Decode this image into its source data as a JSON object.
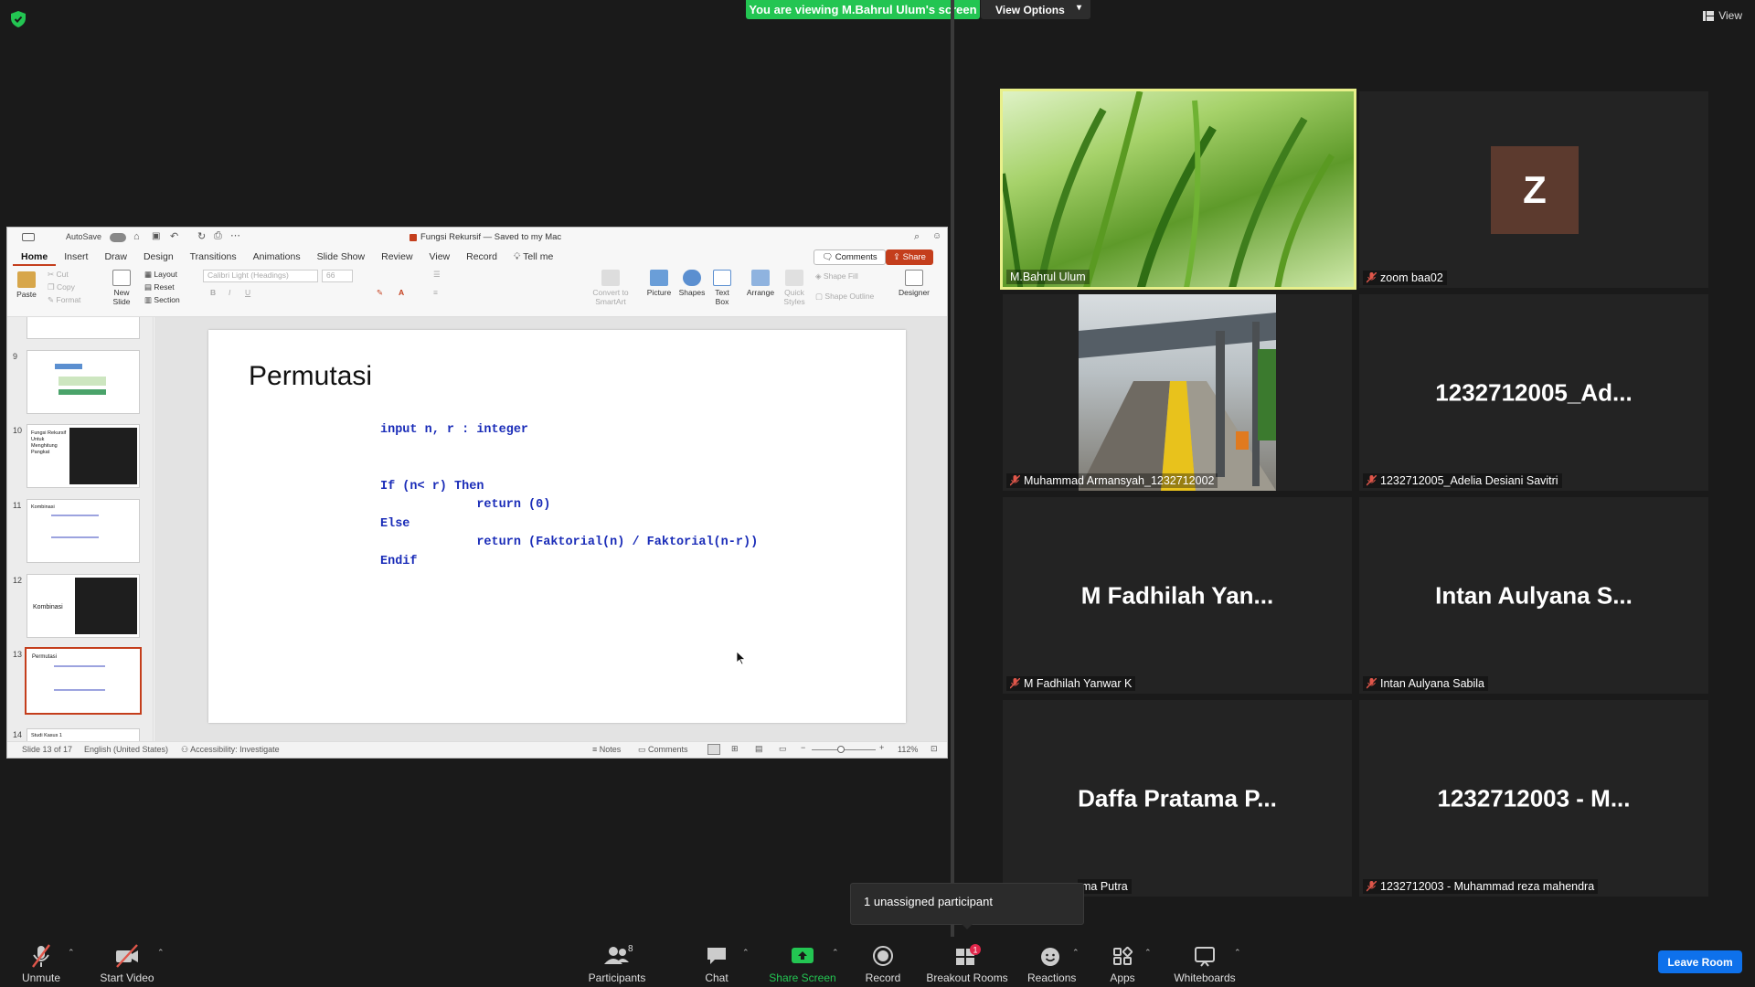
{
  "banner": {
    "viewing_text": "You are viewing M.Bahrul Ulum's screen",
    "view_options_label": "View Options",
    "view_label": "View"
  },
  "ppt": {
    "autosave_label": "AutoSave",
    "doc_title": "Fungsi Rekursif — Saved to my Mac",
    "tabs": [
      "Home",
      "Insert",
      "Draw",
      "Design",
      "Transitions",
      "Animations",
      "Slide Show",
      "Review",
      "View",
      "Record"
    ],
    "tell_me": "Tell me",
    "comments_button": "Comments",
    "share_button": "Share",
    "ribbon": {
      "paste": "Paste",
      "cut": "Cut",
      "copy": "Copy",
      "format": "Format",
      "new_slide": "New Slide",
      "layout": "Layout",
      "reset": "Reset",
      "section": "Section",
      "font_name": "Calibri Light (Headings)",
      "font_size": "66",
      "convert_smartart": "Convert to SmartArt",
      "picture": "Picture",
      "shapes": "Shapes",
      "text_box": "Text Box",
      "arrange": "Arrange",
      "quick_styles": "Quick Styles",
      "shape_fill": "Shape Fill",
      "shape_outline": "Shape Outline",
      "designer": "Designer"
    },
    "thumbnails": [
      {
        "num": "9",
        "label": ""
      },
      {
        "num": "10",
        "label": "Fungsi Rekursif Untuk Menghitung Pangkat"
      },
      {
        "num": "11",
        "label": "Kombinasi"
      },
      {
        "num": "12",
        "label": "Kombinasi"
      },
      {
        "num": "13",
        "label": "Permutasi"
      },
      {
        "num": "14",
        "label": "Studi Kasus 1"
      }
    ],
    "slide": {
      "title": "Permutasi",
      "code": "input n, r : integer\n\n\nIf (n< r) Then\n             return (0)\nElse\n             return (Faktorial(n) / Faktorial(n-r))\nEndif"
    },
    "status": {
      "slide_info": "Slide 13 of 17",
      "language": "English (United States)",
      "accessibility": "Accessibility: Investigate",
      "notes": "Notes",
      "comments": "Comments",
      "zoom": "112%"
    }
  },
  "participants": [
    {
      "name": "M.Bahrul Ulum",
      "big": "",
      "muted": false,
      "video": "grass"
    },
    {
      "name": "zoom baa02",
      "big": "Z",
      "muted": true,
      "video": "avatar"
    },
    {
      "name": "Muhammad Armansyah_1232712002",
      "big": "",
      "muted": true,
      "video": "station"
    },
    {
      "name": "1232712005_Adelia Desiani Savitri",
      "big": "1232712005_Ad...",
      "muted": true,
      "video": "none"
    },
    {
      "name": "M Fadhilah Yanwar K",
      "big": "M Fadhilah Yan...",
      "muted": true,
      "video": "none"
    },
    {
      "name": "Intan Aulyana Sabila",
      "big": "Intan Aulyana S...",
      "muted": true,
      "video": "none"
    },
    {
      "name": "ma Putra",
      "big": "Daffa Pratama P...",
      "muted": false,
      "video": "none"
    },
    {
      "name": "1232712003 - Muhammad reza mahendra",
      "big": "1232712003 - M...",
      "muted": true,
      "video": "none"
    }
  ],
  "popup": {
    "text": "1 unassigned participant"
  },
  "toolbar": {
    "unmute": "Unmute",
    "start_video": "Start Video",
    "participants": "Participants",
    "participants_count": "8",
    "chat": "Chat",
    "share_screen": "Share Screen",
    "record": "Record",
    "breakout_rooms": "Breakout Rooms",
    "breakout_badge": "1",
    "reactions": "Reactions",
    "apps": "Apps",
    "whiteboards": "Whiteboards",
    "leave_room": "Leave Room"
  },
  "colors": {
    "banner_green": "#23c552",
    "active_speaker": "#e8f08a",
    "share_green": "#23c552",
    "leave_blue": "#0e71eb",
    "code_blue": "#1a2cb8",
    "ppt_accent": "#c43e1c"
  }
}
